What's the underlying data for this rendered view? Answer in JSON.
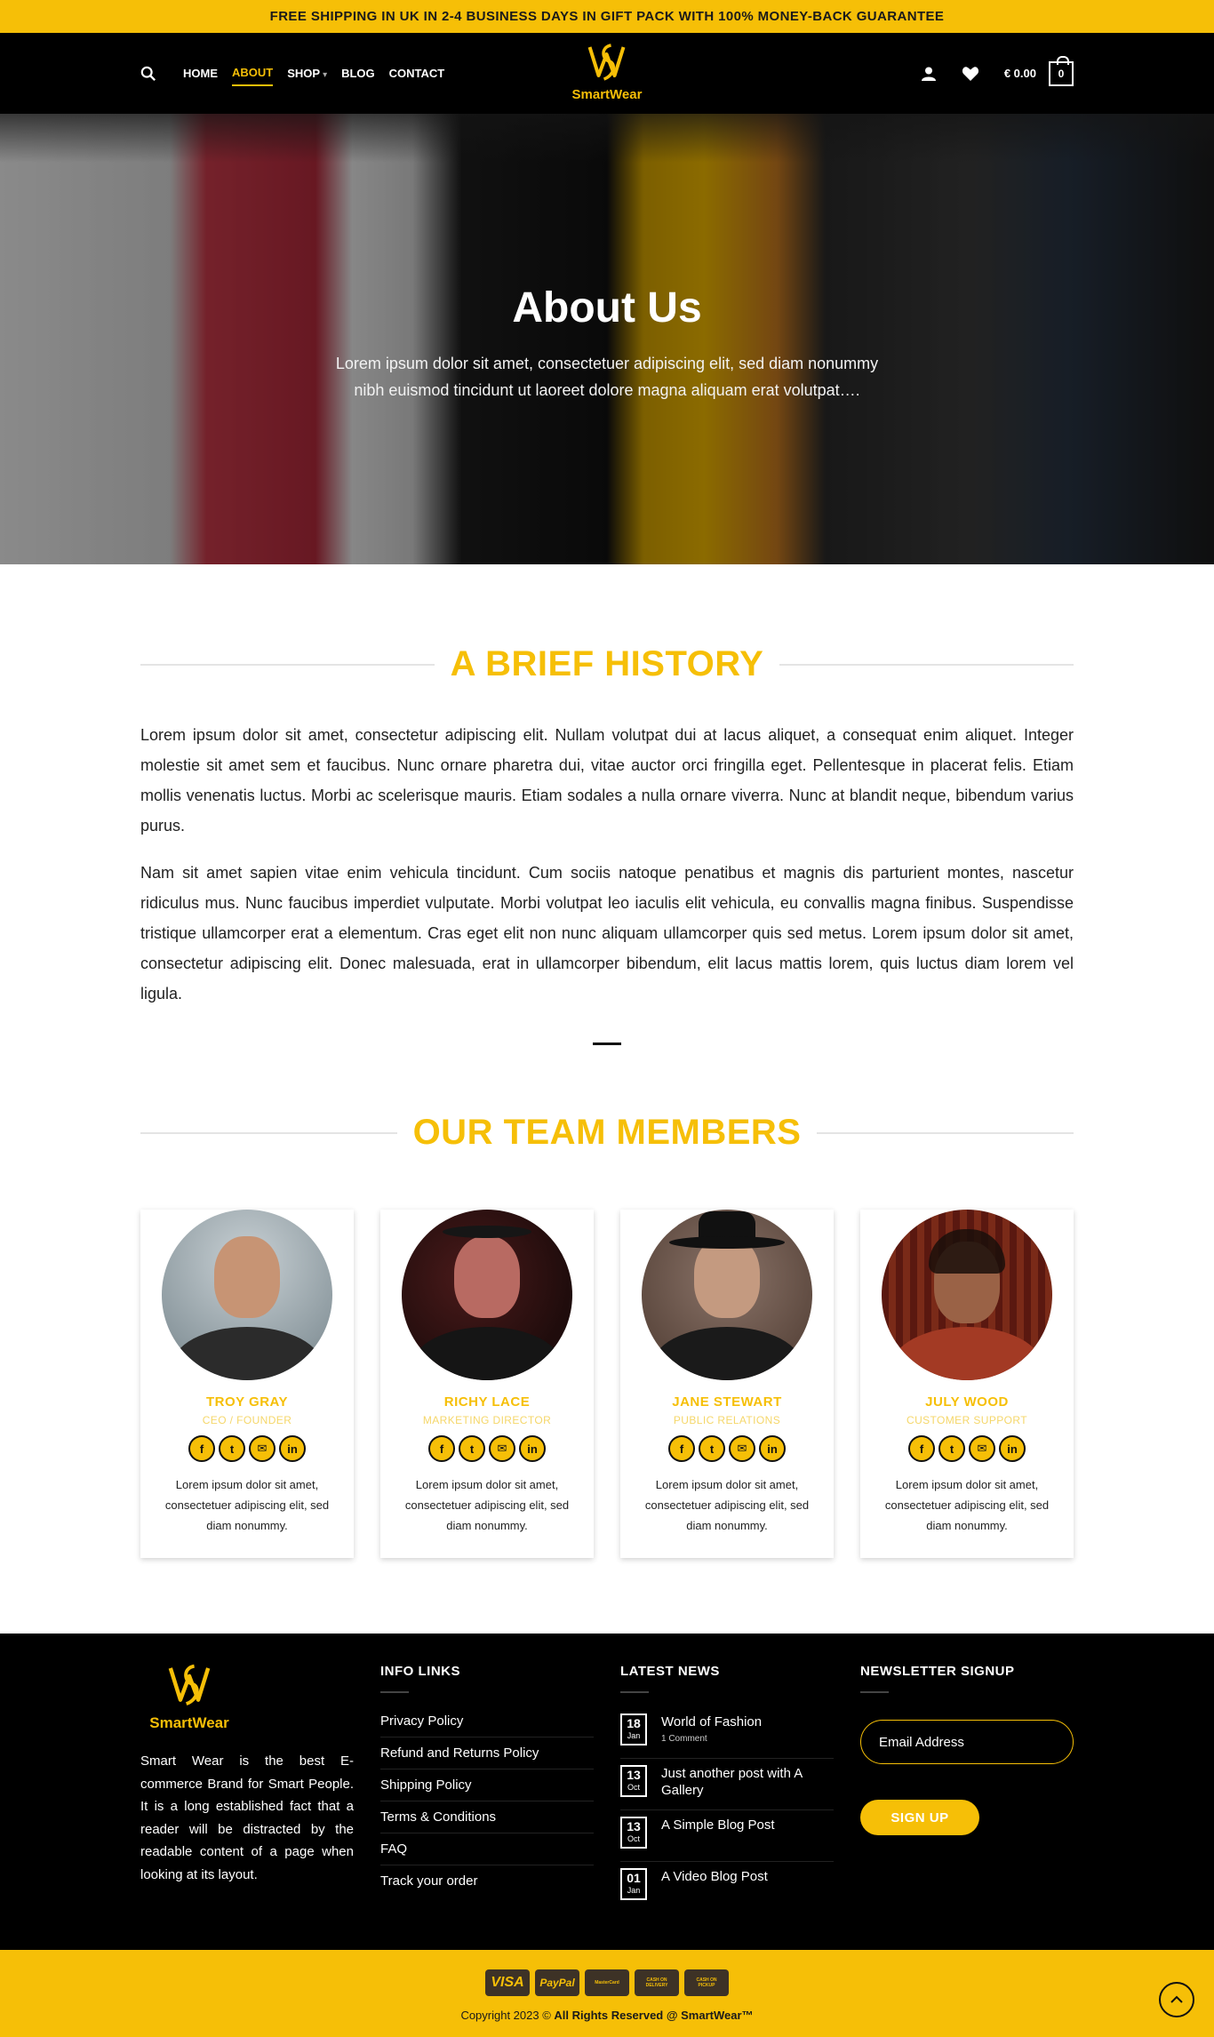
{
  "topbar": {
    "text": "FREE SHIPPING IN UK IN 2-4 BUSINESS DAYS IN GIFT PACK WITH 100% MONEY-BACK GUARANTEE"
  },
  "nav": {
    "items": [
      {
        "label": "HOME"
      },
      {
        "label": "ABOUT"
      },
      {
        "label": "SHOP"
      },
      {
        "label": "BLOG"
      },
      {
        "label": "CONTACT"
      }
    ],
    "active": "ABOUT"
  },
  "logo": {
    "text": "SmartWear"
  },
  "header": {
    "cart_price": "€ 0.00",
    "cart_count": "0"
  },
  "hero": {
    "title": "About Us",
    "subtitle": "Lorem ipsum dolor sit amet, consectetuer adipiscing elit, sed diam nonummy nibh euismod tincidunt ut laoreet dolore magna aliquam erat volutpat…."
  },
  "history": {
    "title": "A BRIEF HISTORY",
    "p1": "Lorem ipsum dolor sit amet, consectetur adipiscing elit. Nullam volutpat dui at lacus aliquet, a consequat enim aliquet. Integer molestie sit amet sem et faucibus. Nunc ornare pharetra dui, vitae auctor orci fringilla eget. Pellentesque in placerat felis. Etiam mollis venenatis luctus. Morbi ac scelerisque mauris. Etiam sodales a nulla ornare viverra. Nunc at blandit neque, bibendum varius purus.",
    "p2": "Nam sit amet sapien vitae enim vehicula tincidunt. Cum sociis natoque penatibus et magnis dis parturient montes, nascetur ridiculus mus. Nunc faucibus imperdiet vulputate. Morbi volutpat leo iaculis elit vehicula, eu convallis magna finibus. Suspendisse tristique ullamcorper erat a elementum. Cras eget elit non nunc aliquam ullamcorper quis sed metus. Lorem ipsum dolor sit amet, consectetur adipiscing elit. Donec malesuada, erat in ullamcorper bibendum, elit lacus mattis lorem, quis luctus diam lorem vel ligula."
  },
  "team": {
    "title": "OUR TEAM MEMBERS",
    "members": [
      {
        "name": "TROY GRAY",
        "role": "CEO / FOUNDER",
        "bio": "Lorem ipsum dolor sit amet, consectetuer adipiscing elit, sed diam nonummy."
      },
      {
        "name": "RICHY LACE",
        "role": "MARKETING DIRECTOR",
        "bio": "Lorem ipsum dolor sit amet, consectetuer adipiscing elit, sed diam nonummy."
      },
      {
        "name": "JANE STEWART",
        "role": "PUBLIC RELATIONS",
        "bio": "Lorem ipsum dolor sit amet, consectetuer adipiscing elit, sed diam nonummy."
      },
      {
        "name": "JULY WOOD",
        "role": "CUSTOMER SUPPORT",
        "bio": "Lorem ipsum dolor sit amet, consectetuer adipiscing elit, sed diam nonummy."
      }
    ],
    "social_icons": [
      "facebook-icon",
      "twitter-icon",
      "email-icon",
      "linkedin-icon"
    ]
  },
  "footer": {
    "logo_text": "SmartWear",
    "description": "Smart Wear is the best E-commerce Brand for Smart People. It is a long established fact that a reader will be distracted by the readable content of a page when looking at its layout.",
    "info_title": "INFO LINKS",
    "info_links": [
      "Privacy Policy",
      "Refund and Returns Policy",
      "Shipping Policy",
      "Terms & Conditions",
      "FAQ",
      "Track your order"
    ],
    "news_title": "LATEST NEWS",
    "news": [
      {
        "day": "18",
        "month": "Jan",
        "title": "World of Fashion",
        "comments": "1 Comment"
      },
      {
        "day": "13",
        "month": "Oct",
        "title": "Just another post with A Gallery",
        "comments": ""
      },
      {
        "day": "13",
        "month": "Oct",
        "title": "A Simple Blog Post",
        "comments": ""
      },
      {
        "day": "01",
        "month": "Jan",
        "title": "A Video Blog Post",
        "comments": ""
      }
    ],
    "newsletter_title": "NEWSLETTER SIGNUP",
    "email_placeholder": "Email Address",
    "signup_label": "SIGN UP"
  },
  "bottom": {
    "payments": [
      "VISA",
      "PayPal",
      "MasterCard",
      "CASH ON DELIVERY",
      "CASH ON PICKUP"
    ],
    "copyright_prefix": "Copyright 2023 ©",
    "copyright_bold": "All Rights Reserved @ SmartWear™"
  },
  "colors": {
    "accent": "#f6bf07",
    "dark": "#000000"
  }
}
